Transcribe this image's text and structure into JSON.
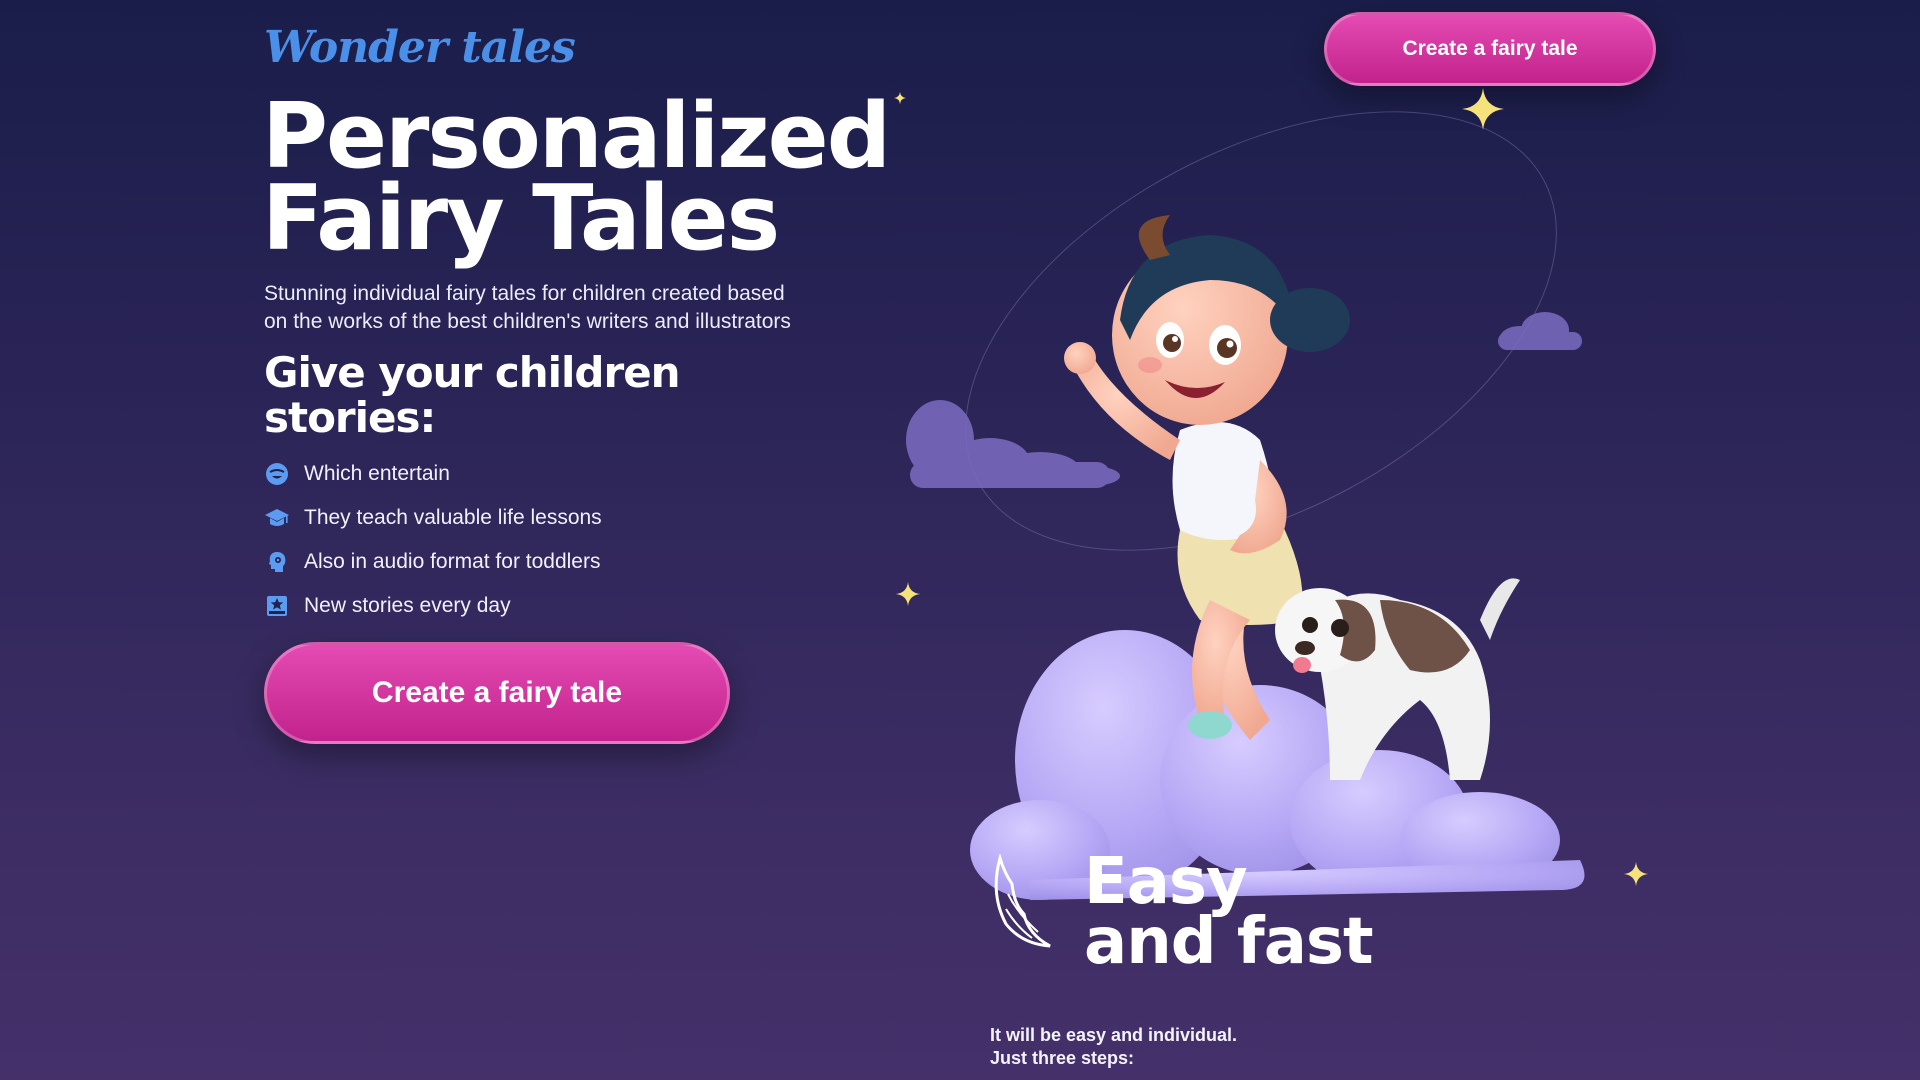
{
  "header": {
    "logo": "Wonder tales",
    "cta_label": "Create a fairy tale"
  },
  "hero": {
    "title_line1": "Personalized",
    "title_line2": "Fairy Tales",
    "subtitle_line1": "Stunning individual fairy tales for children created based",
    "subtitle_line2": "on the works of the best children's writers and illustrators",
    "stories_title_line1": "Give your children",
    "stories_title_line2": "stories:",
    "features": [
      {
        "icon": "smile-icon",
        "label": "Which entertain"
      },
      {
        "icon": "graduation-cap-icon",
        "label": "They teach valuable life lessons"
      },
      {
        "icon": "audio-head-icon",
        "label": "Also in audio format for toddlers"
      },
      {
        "icon": "star-book-icon",
        "label": "New stories every day"
      }
    ],
    "cta_label": "Create a fairy tale"
  },
  "easy_section": {
    "title_line1": "Easy",
    "title_line2": "and fast",
    "text_line1": "It will be easy and individual.",
    "text_line2": "Just three steps:"
  },
  "colors": {
    "accent_pink": "#d12f9f",
    "logo_blue": "#4a90e8",
    "icon_blue": "#5b9bf0",
    "cloud_lavender": "#b9aef7",
    "star_yellow": "#f6e27a"
  }
}
